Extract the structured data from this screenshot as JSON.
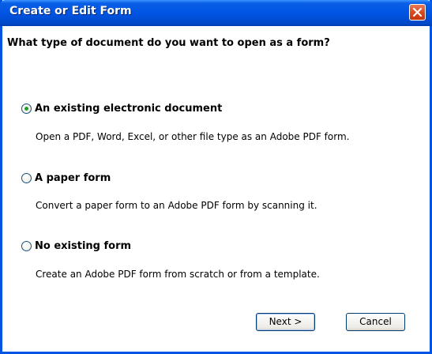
{
  "window": {
    "title": "Create or Edit Form"
  },
  "question": "What type of document do you want to open as a form?",
  "options": [
    {
      "label": "An existing electronic document",
      "description": "Open a PDF, Word, Excel, or other file type as an Adobe PDF form.",
      "selected": true
    },
    {
      "label": "A paper form",
      "description": "Convert a paper form to an Adobe PDF form by scanning it.",
      "selected": false
    },
    {
      "label": "No existing form",
      "description": "Create an Adobe PDF form from scratch or from a template.",
      "selected": false
    }
  ],
  "buttons": {
    "next": "Next >",
    "cancel": "Cancel"
  },
  "colors": {
    "titlebar": "#0054e3",
    "close_button": "#d9461c",
    "radio_dot": "#21a121"
  }
}
